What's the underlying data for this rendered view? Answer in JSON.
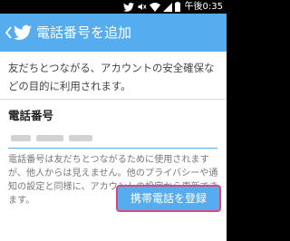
{
  "status_bar": {
    "time": "午後0:35",
    "icons": [
      "twitter-bird-icon",
      "mute-icon",
      "wifi-icon",
      "signal-icon",
      "battery-icon"
    ]
  },
  "app_bar": {
    "title": "電話番号を追加",
    "back_icon": "back-arrow-icon",
    "logo_icon": "twitter-bird-icon",
    "color": "#55ACEE"
  },
  "main": {
    "intro_text": "友だちとつながる、アカウントの安全確保などの目的に利用されます。",
    "phone_field": {
      "label": "電話番号"
    },
    "note_text": "電話番号は友だちとつながるために使用されますが、他人からは見えません。他のプライバシーや通知の設定と同様に、アカウントの設定から更新できます。",
    "register_button": {
      "label": "携帯電話を登録",
      "highlight_color": "#e0457b"
    }
  }
}
